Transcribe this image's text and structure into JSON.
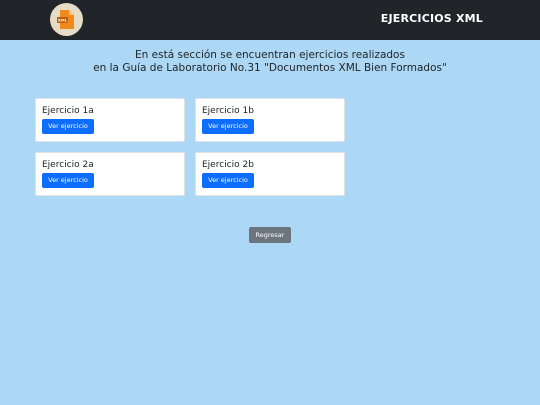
{
  "header": {
    "logo_icon": "xml-file-icon",
    "logo_badge": "XML",
    "title": "EJERCICIOS XML"
  },
  "intro": {
    "line1": "En está sección se encuentran ejercicios realizados",
    "line2": "en la Guía de Laboratorio No.31 \"Documentos XML Bien Formados\""
  },
  "cards": [
    {
      "title": "Ejercicio 1a",
      "button": "Ver ejercicio"
    },
    {
      "title": "Ejercicio 1b",
      "button": "Ver ejercicio"
    },
    {
      "title": "Ejercicio 2a",
      "button": "Ver ejercicio"
    },
    {
      "title": "Ejercicio 2b",
      "button": "Ver ejercicio"
    }
  ],
  "back_button": "Regresar",
  "colors": {
    "navbar": "#212529",
    "background": "#acd8f5",
    "primary": "#0d6efd",
    "secondary": "#6c757d"
  }
}
